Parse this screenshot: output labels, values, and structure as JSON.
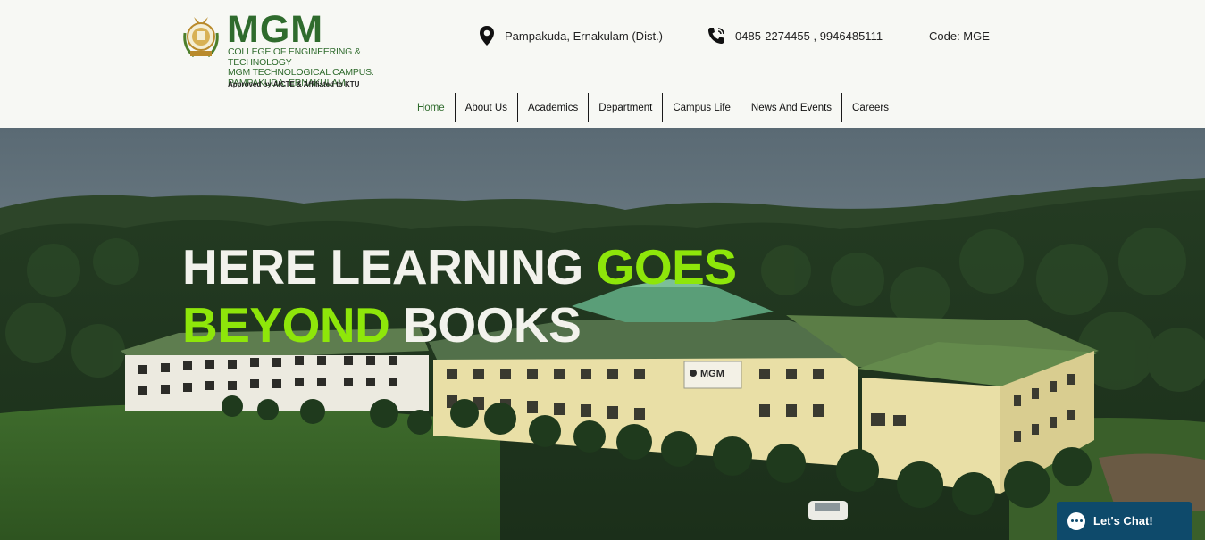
{
  "brand": {
    "name": "MGM",
    "line1": "COLLEGE OF ENGINEERING & TECHNOLOGY",
    "line2": "MGM TECHNOLOGICAL CAMPUS.",
    "line3": "PAMPAKUDA, ERNAKULAM",
    "note": "Approved by AICTE & Affiliated to KTU"
  },
  "contact": {
    "location": "Pampakuda, Ernakulam (Dist.)",
    "phone": "0485-2274455 , 9946485111",
    "code": "Code: MGE"
  },
  "nav": [
    {
      "label": "Home"
    },
    {
      "label": "About Us"
    },
    {
      "label": "Academics"
    },
    {
      "label": "Department"
    },
    {
      "label": "Campus Life"
    },
    {
      "label": "News And Events"
    },
    {
      "label": "Careers"
    }
  ],
  "hero": {
    "line1_white": "HERE LEARNING ",
    "line1_green": "GOES",
    "line2_green": "BEYOND ",
    "line2_white": "BOOKS",
    "building_sign": "MGM"
  },
  "chat": {
    "label": "Let's Chat!"
  },
  "icons": {
    "location": "location-pin-icon",
    "phone": "phone-icon",
    "chat": "chat-bubble-icon"
  },
  "colors": {
    "brand_green": "#2f6b2d",
    "accent_green": "#8ee60a",
    "chat_blue": "#0e4a6b"
  }
}
